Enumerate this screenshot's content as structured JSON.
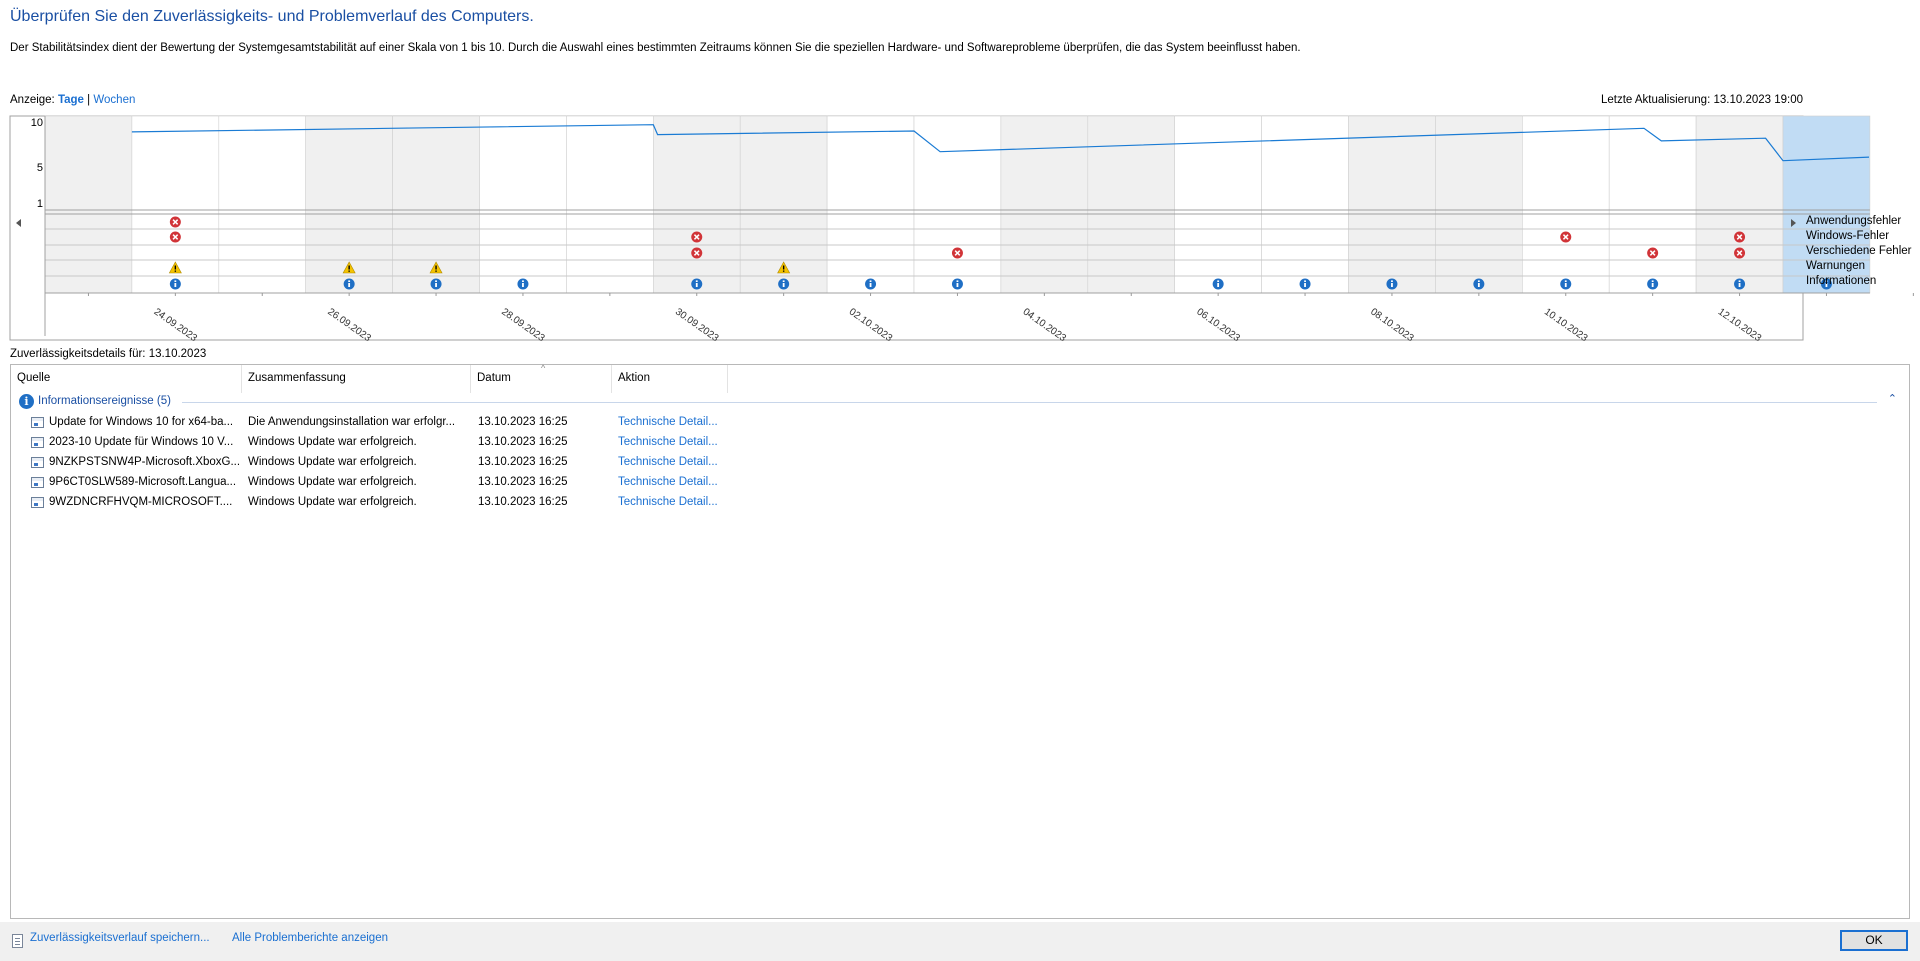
{
  "page": {
    "heading": "Überprüfen Sie den Zuverlässigkeits- und Problemverlauf des Computers.",
    "intro": "Der Stabilitätsindex dient der Bewertung der Systemgesamtstabilität auf einer Skala von 1 bis 10. Durch die Auswahl eines bestimmten Zeitraums können Sie die speziellen Hardware- und Softwareprobleme überprüfen, die das System beeinflusst haben."
  },
  "view": {
    "label": "Anzeige:",
    "days": "Tage",
    "separator": "|",
    "weeks": "Wochen",
    "selected": "Tage"
  },
  "last_update": "Letzte Aktualisierung: 13.10.2023 19:00",
  "chart_data": {
    "type": "line",
    "y_ticks": [
      "10",
      "5",
      "1"
    ],
    "ylim": [
      1,
      10
    ],
    "days": [
      "23.09",
      "24.09",
      "25.09",
      "26.09",
      "27.09",
      "28.09",
      "29.09",
      "30.09",
      "01.10",
      "02.10",
      "03.10",
      "04.10",
      "05.10",
      "06.10",
      "07.10",
      "08.10",
      "09.10",
      "10.10",
      "11.10",
      "12.10",
      "13.10"
    ],
    "date_labels": [
      "24.09.2023",
      "26.09.2023",
      "28.09.2023",
      "30.09.2023",
      "02.10.2023",
      "04.10.2023",
      "06.10.2023",
      "08.10.2023",
      "10.10.2023",
      "12.10.2023"
    ],
    "selected_day": "13.10",
    "stability_index": [
      {
        "day": 1,
        "value": 8.9
      },
      {
        "day": 7.0,
        "value": 9.7
      },
      {
        "day": 7.05,
        "value": 8.6
      },
      {
        "day": 10.0,
        "value": 9.0
      },
      {
        "day": 10.3,
        "value": 6.7
      },
      {
        "day": 18.4,
        "value": 9.3
      },
      {
        "day": 18.6,
        "value": 7.9
      },
      {
        "day": 19.8,
        "value": 8.2
      },
      {
        "day": 20.0,
        "value": 5.7
      },
      {
        "day": 20.99,
        "value": 6.1
      }
    ],
    "event_rows": [
      "Anwendungsfehler",
      "Windows-Fehler",
      "Verschiedene Fehler",
      "Warnungen",
      "Informationen"
    ],
    "events": [
      {
        "row": 0,
        "days": [
          1
        ]
      },
      {
        "row": 1,
        "days": [
          1,
          7,
          17,
          19
        ]
      },
      {
        "row": 2,
        "days": [
          7,
          10,
          18,
          19
        ]
      },
      {
        "row": 3,
        "days": [
          1,
          3,
          4,
          8
        ]
      },
      {
        "row": 4,
        "days": [
          1,
          3,
          4,
          5,
          7,
          8,
          9,
          10,
          13,
          14,
          15,
          16,
          17,
          18,
          19,
          20
        ]
      }
    ],
    "colors": {
      "line": "#1a7bd4",
      "error": "#d13438",
      "warning": "#f4c300",
      "info": "#1f6fc5",
      "selected": "#c1dcf4",
      "shaded": "#f0f0f0"
    }
  },
  "details": {
    "label": "Zuverlässigkeitsdetails für: 13.10.2023",
    "columns": [
      "Quelle",
      "Zusammenfassung",
      "Datum",
      "Aktion"
    ],
    "group": {
      "label": "Informationsereignisse (5)",
      "icon": "info-icon"
    },
    "rows": [
      {
        "source": "Update for Windows 10 for x64-ba...",
        "summary": "Die Anwendungsinstallation war erfolgr...",
        "date": "13.10.2023 16:25",
        "action": "Technische Detail..."
      },
      {
        "source": "2023-10 Update für Windows 10 V...",
        "summary": "Windows Update war erfolgreich.",
        "date": "13.10.2023 16:25",
        "action": "Technische Detail..."
      },
      {
        "source": "9NZKPSTSNW4P-Microsoft.XboxG...",
        "summary": "Windows Update war erfolgreich.",
        "date": "13.10.2023 16:25",
        "action": "Technische Detail..."
      },
      {
        "source": "9P6CT0SLW589-Microsoft.Langua...",
        "summary": "Windows Update war erfolgreich.",
        "date": "13.10.2023 16:25",
        "action": "Technische Detail..."
      },
      {
        "source": "9WZDNCRFHVQM-MICROSOFT....",
        "summary": "Windows Update war erfolgreich.",
        "date": "13.10.2023 16:25",
        "action": "Technische Detail..."
      }
    ]
  },
  "footer": {
    "save_link": "Zuverlässigkeitsverlauf speichern...",
    "all_reports_link": "Alle Problemberichte anzeigen",
    "ok_label": "OK"
  }
}
